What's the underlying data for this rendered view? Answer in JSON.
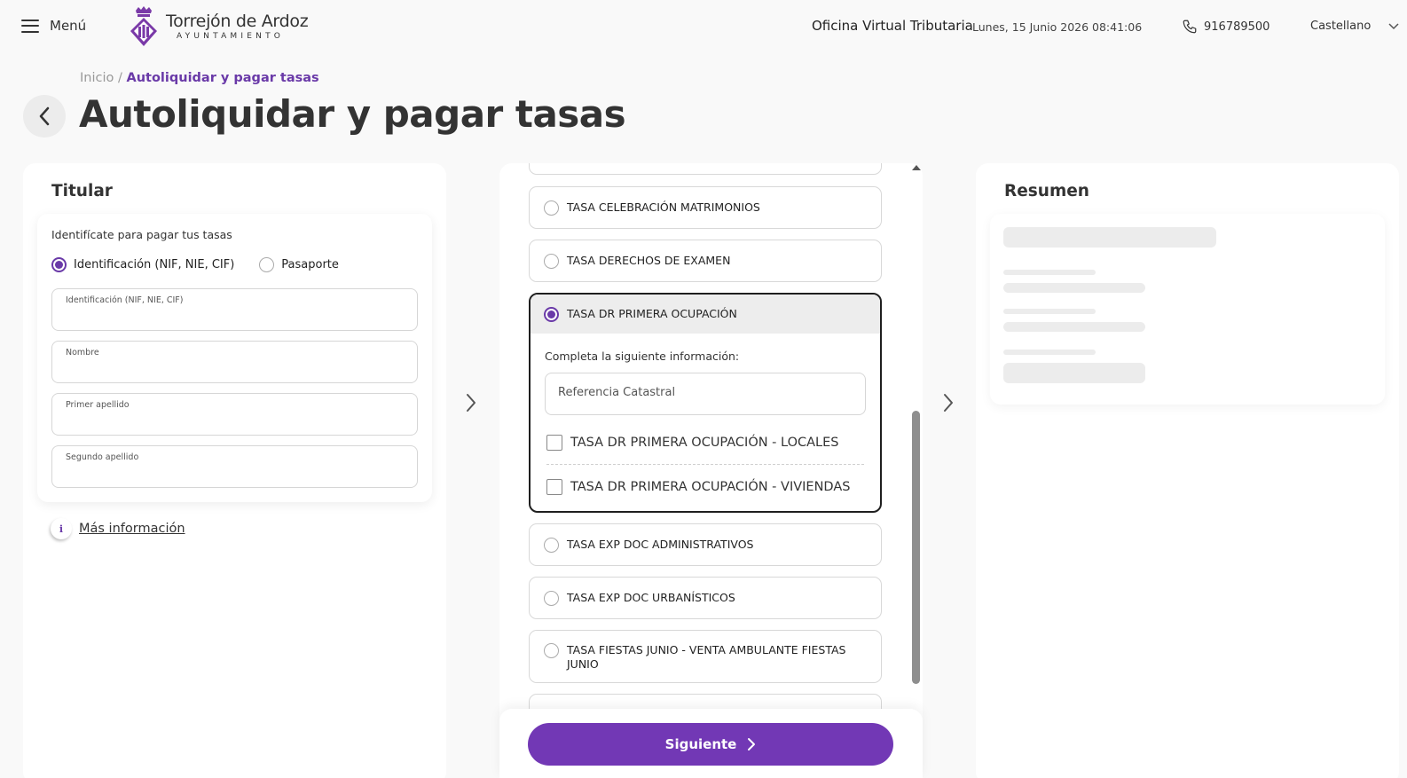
{
  "header": {
    "menu_label": "Menú",
    "logo_name": "Torrejón de Ardoz",
    "logo_sub": "AYUNTAMIENTO",
    "office": "Oficina Virtual Tributaria",
    "datetime": "Lunes, 15 Junio 2026 08:41:06",
    "phone": "916789500",
    "language": "Castellano"
  },
  "breadcrumb": {
    "home": "Inicio",
    "sep": " / ",
    "current": "Autoliquidar y pagar tasas"
  },
  "page_title": "Autoliquidar y pagar tasas",
  "titular": {
    "title": "Titular",
    "hint": "Identifícate para pagar tus tasas",
    "id_types": [
      {
        "label": "Identificación (NIF, NIE, CIF)",
        "selected": true
      },
      {
        "label": "Pasaporte",
        "selected": false
      }
    ],
    "fields": [
      {
        "label": "Identificación (NIF, NIE, CIF)",
        "value": ""
      },
      {
        "label": "Nombre",
        "value": ""
      },
      {
        "label": "Primer apellido",
        "value": ""
      },
      {
        "label": "Segundo apellido",
        "value": ""
      }
    ],
    "more_info": "Más información"
  },
  "tasas": {
    "options": [
      {
        "label": "TASA CELEBRACIÓN MATRIMONIOS",
        "selected": false
      },
      {
        "label": "TASA DERECHOS DE EXAMEN",
        "selected": false
      },
      {
        "label": "TASA DR PRIMERA OCUPACIÓN",
        "selected": true
      },
      {
        "label": "TASA EXP DOC ADMINISTRATIVOS",
        "selected": false
      },
      {
        "label": "TASA EXP DOC URBANÍSTICOS",
        "selected": false
      },
      {
        "label": "TASA FIESTAS JUNIO - VENTA AMBULANTE FIESTAS JUNIO",
        "selected": false
      }
    ],
    "expanded": {
      "hint": "Completa la siguiente información:",
      "ref_placeholder": "Referencia Catastral",
      "subitems": [
        {
          "label": "TASA DR PRIMERA OCUPACIÓN - LOCALES",
          "checked": false
        },
        {
          "label": "TASA DR PRIMERA OCUPACIÓN - VIVIENDAS",
          "checked": false
        }
      ]
    },
    "next_label": "Siguiente"
  },
  "resumen": {
    "title": "Resumen"
  },
  "colors": {
    "accent": "#6a3aa8",
    "button": "#7238b5",
    "background": "#f9f9f9"
  },
  "icons": [
    "menu-icon",
    "crest-logo",
    "phone-icon",
    "chevron-down-icon",
    "chevron-left-icon",
    "chevron-right-icon",
    "info-icon"
  ]
}
